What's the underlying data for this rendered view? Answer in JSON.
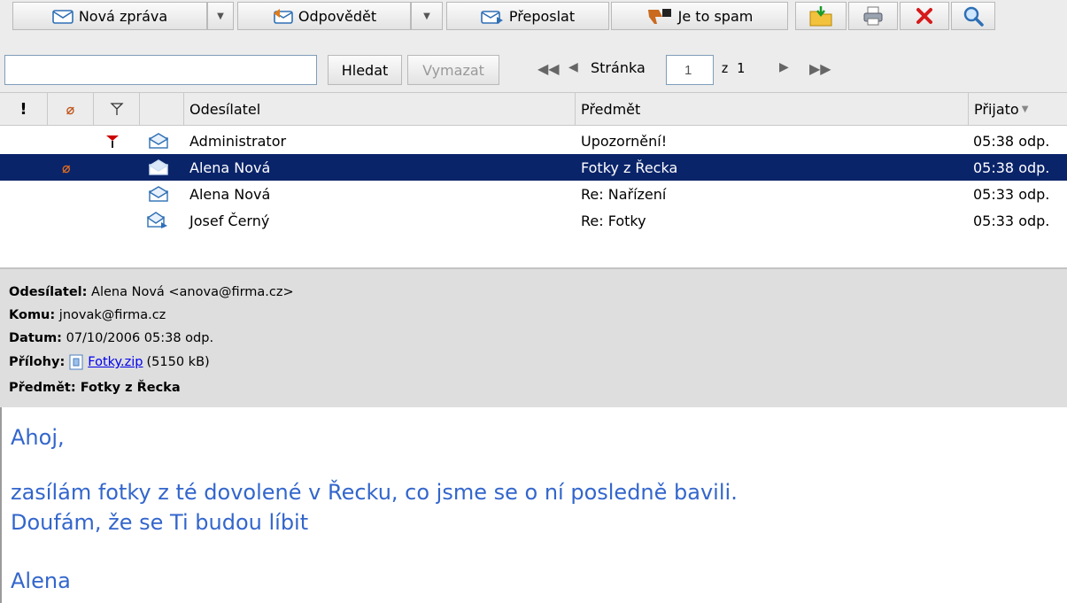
{
  "toolbar": {
    "new_message": "Nová zpráva",
    "reply": "Odpovědět",
    "forward": "Přeposlat",
    "spam": "Je to spam"
  },
  "search": {
    "value": "",
    "search_label": "Hledat",
    "clear_label": "Vymazat",
    "page_label": "Stránka",
    "page_value": "1",
    "page_of": "z 1"
  },
  "columns": {
    "priority": "!",
    "sender": "Odesílatel",
    "subject": "Předmět",
    "received": "Přijato"
  },
  "messages": [
    {
      "sender": "Administrator",
      "subject": "Upozornění!",
      "received": "05:38 odp."
    },
    {
      "sender": "Alena Nová",
      "subject": "Fotky z Řecka",
      "received": "05:38 odp."
    },
    {
      "sender": "Alena Nová",
      "subject": "Re: Nařízení",
      "received": "05:33 odp."
    },
    {
      "sender": "Josef Černý",
      "subject": "Re: Fotky",
      "received": "05:33 odp."
    }
  ],
  "preview": {
    "from_label": "Odesílatel:",
    "from_value": "Alena Nová <anova@firma.cz>",
    "to_label": "Komu:",
    "to_value": "jnovak@firma.cz",
    "date_label": "Datum:",
    "date_value": "07/10/2006 05:38 odp.",
    "attach_label": "Přílohy:",
    "attach_name": "Fotky.zip",
    "attach_size": "(5150 kB)",
    "subject_label": "Předmět:",
    "subject_value": "Fotky z Řecka"
  },
  "body": {
    "greeting": "Ahoj,",
    "line1": "zasílám fotky z té dovolené v Řecku, co jsme se o ní posledně bavili.",
    "line2": "Doufám, že se Ti budou líbit",
    "signature": "Alena"
  }
}
